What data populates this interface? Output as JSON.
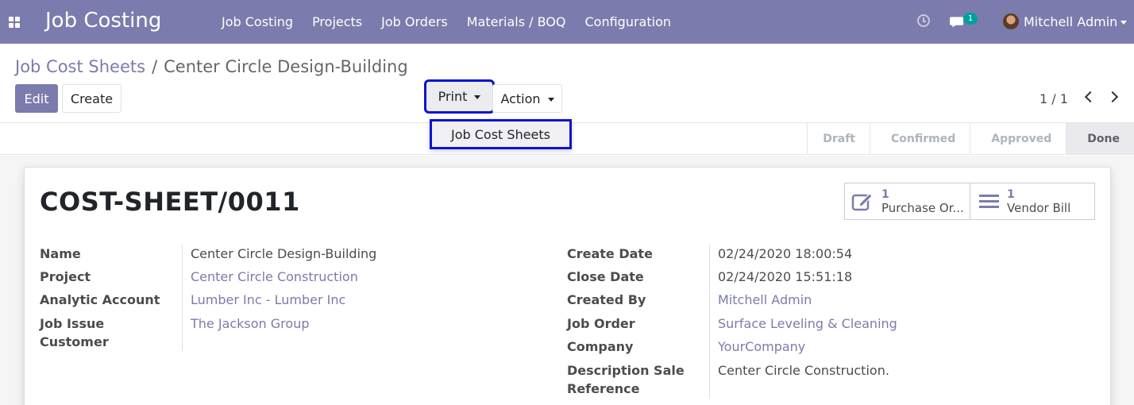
{
  "navbar": {
    "app_title": "Job Costing",
    "menu": [
      "Job Costing",
      "Projects",
      "Job Orders",
      "Materials / BOQ",
      "Configuration"
    ],
    "chat_count": "1",
    "user": "Mitchell Admin",
    "bg_color": "#7c7bad"
  },
  "breadcrumb": {
    "parent": "Job Cost Sheets",
    "separator": "/",
    "current": "Center Circle Design-Building"
  },
  "buttons": {
    "edit": "Edit",
    "create": "Create",
    "print": "Print",
    "action": "Action"
  },
  "print_dropdown": {
    "items": [
      "Job Cost Sheets"
    ]
  },
  "pager": {
    "value": "1 / 1"
  },
  "stages": [
    "Draft",
    "Confirmed",
    "Approved",
    "Done"
  ],
  "active_stage": "Done",
  "record": {
    "title": "COST-SHEET/0011",
    "smart_buttons": [
      {
        "count": "1",
        "label": "Purchase Or...",
        "icon": "edit-icon"
      },
      {
        "count": "1",
        "label": "Vendor Bill",
        "icon": "list-icon"
      }
    ],
    "left_fields": [
      {
        "label": "Name",
        "value": "Center Circle Design-Building"
      },
      {
        "label": "Project",
        "value": "Center Circle Construction"
      },
      {
        "label": "Analytic Account",
        "value": "Lumber Inc - Lumber Inc"
      },
      {
        "label": "Job Issue Customer",
        "value": "The Jackson Group"
      }
    ],
    "right_fields": [
      {
        "label": "Create Date",
        "value": "02/24/2020 18:00:54"
      },
      {
        "label": "Close Date",
        "value": "02/24/2020 15:51:18"
      },
      {
        "label": "Created By",
        "value": "Mitchell Admin"
      },
      {
        "label": "Job Order",
        "value": "Surface Leveling & Cleaning"
      },
      {
        "label": "Company",
        "value": "YourCompany"
      },
      {
        "label": "Description Sale Reference",
        "value": "Center Circle Construction."
      }
    ]
  }
}
